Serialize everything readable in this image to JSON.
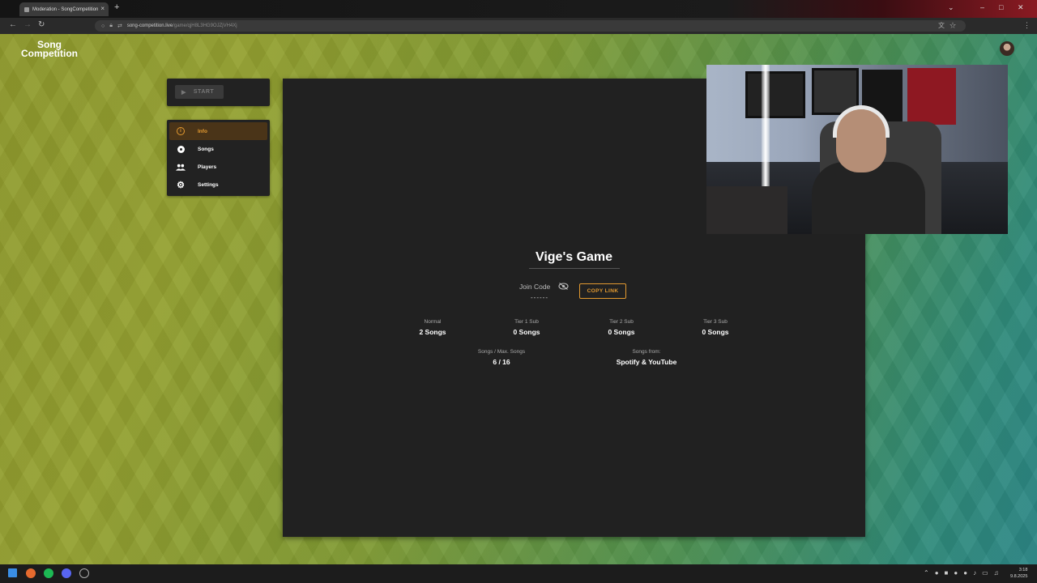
{
  "browser": {
    "tab_title": "Moderation - SongCompetition",
    "url_host": "song-competition.live",
    "url_path": "/game/qjH8L3HG9OJZjVH4Xj"
  },
  "app": {
    "logo_line1": "Song",
    "logo_line2": "Competition"
  },
  "sidebar": {
    "start_label": "START",
    "items": [
      {
        "label": "Info"
      },
      {
        "label": "Songs"
      },
      {
        "label": "Players"
      },
      {
        "label": "Settings"
      }
    ]
  },
  "game": {
    "title": "Vige's Game",
    "join_label": "Join Code",
    "join_code": "------",
    "copy_label": "COPY LINK",
    "stats": [
      {
        "label": "Normal",
        "value": "2 Songs"
      },
      {
        "label": "Tier 1 Sub",
        "value": "0 Songs"
      },
      {
        "label": "Tier 2 Sub",
        "value": "0 Songs"
      },
      {
        "label": "Tier 3 Sub",
        "value": "0 Songs"
      }
    ],
    "songs_label": "Songs / Max. Songs",
    "songs_value": "6 / 16",
    "from_label": "Songs from:",
    "from_value": "Spotify & YouTube"
  },
  "taskbar": {
    "time": "3:18",
    "date": "9.8.2025"
  },
  "colors": {
    "accent": "#e39a30",
    "card_bg": "#212121"
  }
}
